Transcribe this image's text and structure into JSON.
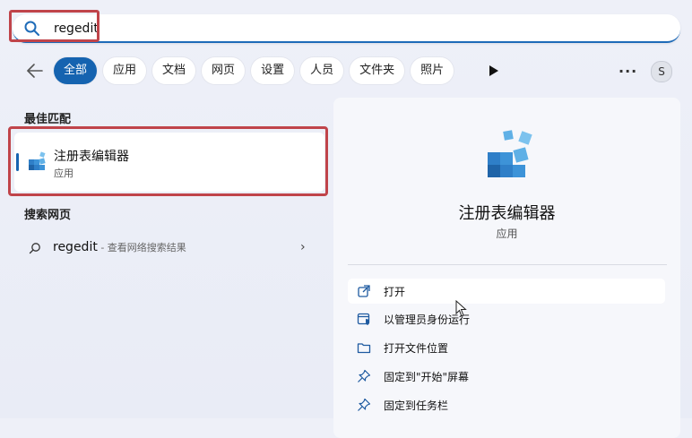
{
  "search": {
    "value": "regedit",
    "placeholder": ""
  },
  "filters": {
    "back_icon": "back-arrow-icon",
    "chips": [
      "全部",
      "应用",
      "文档",
      "网页",
      "设置",
      "人员",
      "文件夹",
      "照片"
    ],
    "active_index": 0,
    "more_label": "···",
    "avatar_letter": "S"
  },
  "best_match": {
    "section_title": "最佳匹配",
    "name": "注册表编辑器",
    "type": "应用"
  },
  "web": {
    "section_title": "搜索网页",
    "query": "regedit",
    "hint": " - 查看网络搜索结果"
  },
  "details": {
    "name": "注册表编辑器",
    "type": "应用",
    "actions": [
      {
        "label": "打开",
        "icon": "open-external-icon"
      },
      {
        "label": "以管理员身份运行",
        "icon": "admin-shield-icon"
      },
      {
        "label": "打开文件位置",
        "icon": "folder-icon"
      },
      {
        "label": "固定到\"开始\"屏幕",
        "icon": "pin-icon"
      },
      {
        "label": "固定到任务栏",
        "icon": "pin-icon"
      }
    ]
  },
  "colors": {
    "accent": "#1563b0",
    "highlight": "#c0444a"
  }
}
